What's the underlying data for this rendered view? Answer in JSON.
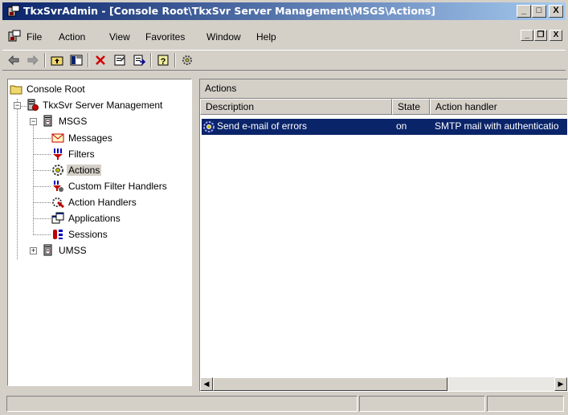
{
  "window": {
    "title": "TkxSvrAdmin - [Console Root\\TkxSvr Server Management\\MSGS\\Actions]",
    "caption_buttons": [
      "_",
      "□",
      "X"
    ]
  },
  "menu": {
    "items": [
      {
        "label": "File",
        "underline": "F"
      },
      {
        "label": "Action",
        "underline": "A"
      },
      {
        "label": "View",
        "underline": "V"
      },
      {
        "label": "Favorites",
        "underline": "o"
      },
      {
        "label": "Window",
        "underline": "W"
      },
      {
        "label": "Help",
        "underline": "H"
      }
    ]
  },
  "toolbar": {
    "buttons": [
      "back-arrow-icon",
      "forward-arrow-icon",
      "up-folder-icon",
      "show-hide-tree-icon",
      "delete-icon",
      "properties-icon",
      "export-list-icon",
      "help-icon",
      "action-settings-icon"
    ]
  },
  "tree": {
    "root": "Console Root",
    "server": "TkxSvr Server Management",
    "msgs": "MSGS",
    "children": [
      "Messages",
      "Filters",
      "Actions",
      "Custom Filter Handlers",
      "Action Handlers",
      "Applications",
      "Sessions"
    ],
    "umss": "UMSS",
    "selected": "Actions"
  },
  "right_pane": {
    "caption": "Actions",
    "columns": [
      "Description",
      "State",
      "Action handler"
    ],
    "rows": [
      {
        "description": "Send e-mail of errors",
        "state": "on",
        "action_handler": "SMTP mail with authenticatio"
      }
    ]
  },
  "colors": {
    "title_start": "#0a246a",
    "title_end": "#a6caf0",
    "selection": "#0a246a",
    "face": "#d4d0c8"
  }
}
